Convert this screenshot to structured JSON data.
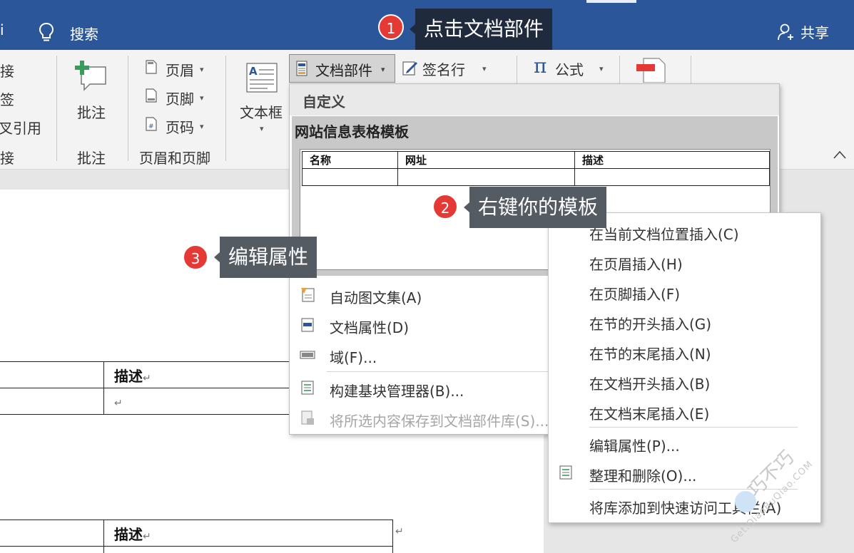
{
  "titlebar": {
    "left_fragment": "i",
    "search_label": "搜索",
    "share_label": "共享"
  },
  "ribbon": {
    "partial_items": [
      "接",
      "签",
      "叉引用"
    ],
    "partial_group": "接",
    "comment_button": "批注",
    "comment_group": "批注",
    "header_label": "页眉",
    "footer_label": "页脚",
    "pagenum_label": "页码",
    "header_footer_group": "页眉和页脚",
    "textbox_label": "文本框",
    "docparts_label": "文档部件",
    "signature_label": "签名行",
    "formula_label": "公式",
    "pi_symbol": "π"
  },
  "gallery": {
    "section_header": "自定义",
    "template_name": "网站信息表格模板",
    "preview_headers": [
      "名称",
      "网址",
      "描述"
    ],
    "menu": [
      {
        "label": "自动图文集(A)",
        "disabled": false
      },
      {
        "label": "文档属性(D)",
        "disabled": false
      },
      {
        "label": "域(F)...",
        "disabled": false
      },
      {
        "label": "构建基块管理器(B)...",
        "disabled": false
      },
      {
        "label": "将所选内容保存到文档部件库(S)...",
        "disabled": true
      }
    ]
  },
  "context_menu": {
    "items": [
      "在当前文档位置插入(C)",
      "在页眉插入(H)",
      "在页脚插入(F)",
      "在节的开头插入(G)",
      "在节的末尾插入(N)",
      "在文档开头插入(B)",
      "在文档末尾插入(E)",
      "编辑属性(P)...",
      "整理和删除(O)...",
      "将库添加到快速访问工具栏(A)"
    ]
  },
  "document": {
    "table1_header": "描述",
    "table2_header": "描述",
    "para_mark": "↵"
  },
  "callouts": [
    {
      "number": "1",
      "text": "点击文档部件"
    },
    {
      "number": "2",
      "text": "右键你的模板"
    },
    {
      "number": "3",
      "text": "编辑属性"
    }
  ],
  "watermark": {
    "brand": "巧不巧",
    "site": "Get.QiaoBuQiao.COM"
  },
  "colors": {
    "title_bar": "#2b579a",
    "badge": "#e53935",
    "callout": "#555b63",
    "callout_dark": "#1f2a3c"
  }
}
